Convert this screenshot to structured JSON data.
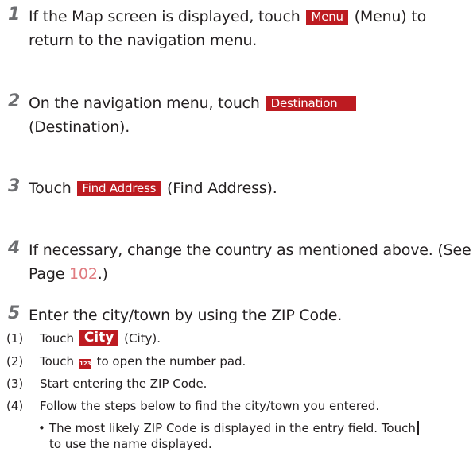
{
  "steps": [
    {
      "num": "1",
      "parts": [
        "If the Map screen is displayed, touch ",
        " (Menu) to return to the navigation menu."
      ],
      "button": "Menu"
    },
    {
      "num": "2",
      "parts": [
        "On the navigation menu, touch ",
        " (Destination)."
      ],
      "button": "Destination"
    },
    {
      "num": "3",
      "parts": [
        "Touch ",
        " (Find Address)."
      ],
      "button": "Find Address"
    },
    {
      "num": "4",
      "text": "If necessary, change the country as mentioned above. (See Page ",
      "page_ref": "102",
      "after": ".)"
    },
    {
      "num": "5",
      "text": "Enter the city/town by using the ZIP Code."
    }
  ],
  "substeps": [
    {
      "idx": "(1)",
      "before": "Touch ",
      "button": "City",
      "after": " (City)."
    },
    {
      "idx": "(2)",
      "before": "Touch ",
      "icon": "123",
      "after": " to open the number pad."
    },
    {
      "idx": "(3)",
      "text": "Start entering the ZIP Code."
    },
    {
      "idx": "(4)",
      "text": "Follow the steps below to find the city/town you entered."
    }
  ],
  "bullets": [
    {
      "dot": "•",
      "line1": "The most likely ZIP Code is displayed in the entry field. Touch",
      "line2": "to use the name displayed."
    }
  ]
}
